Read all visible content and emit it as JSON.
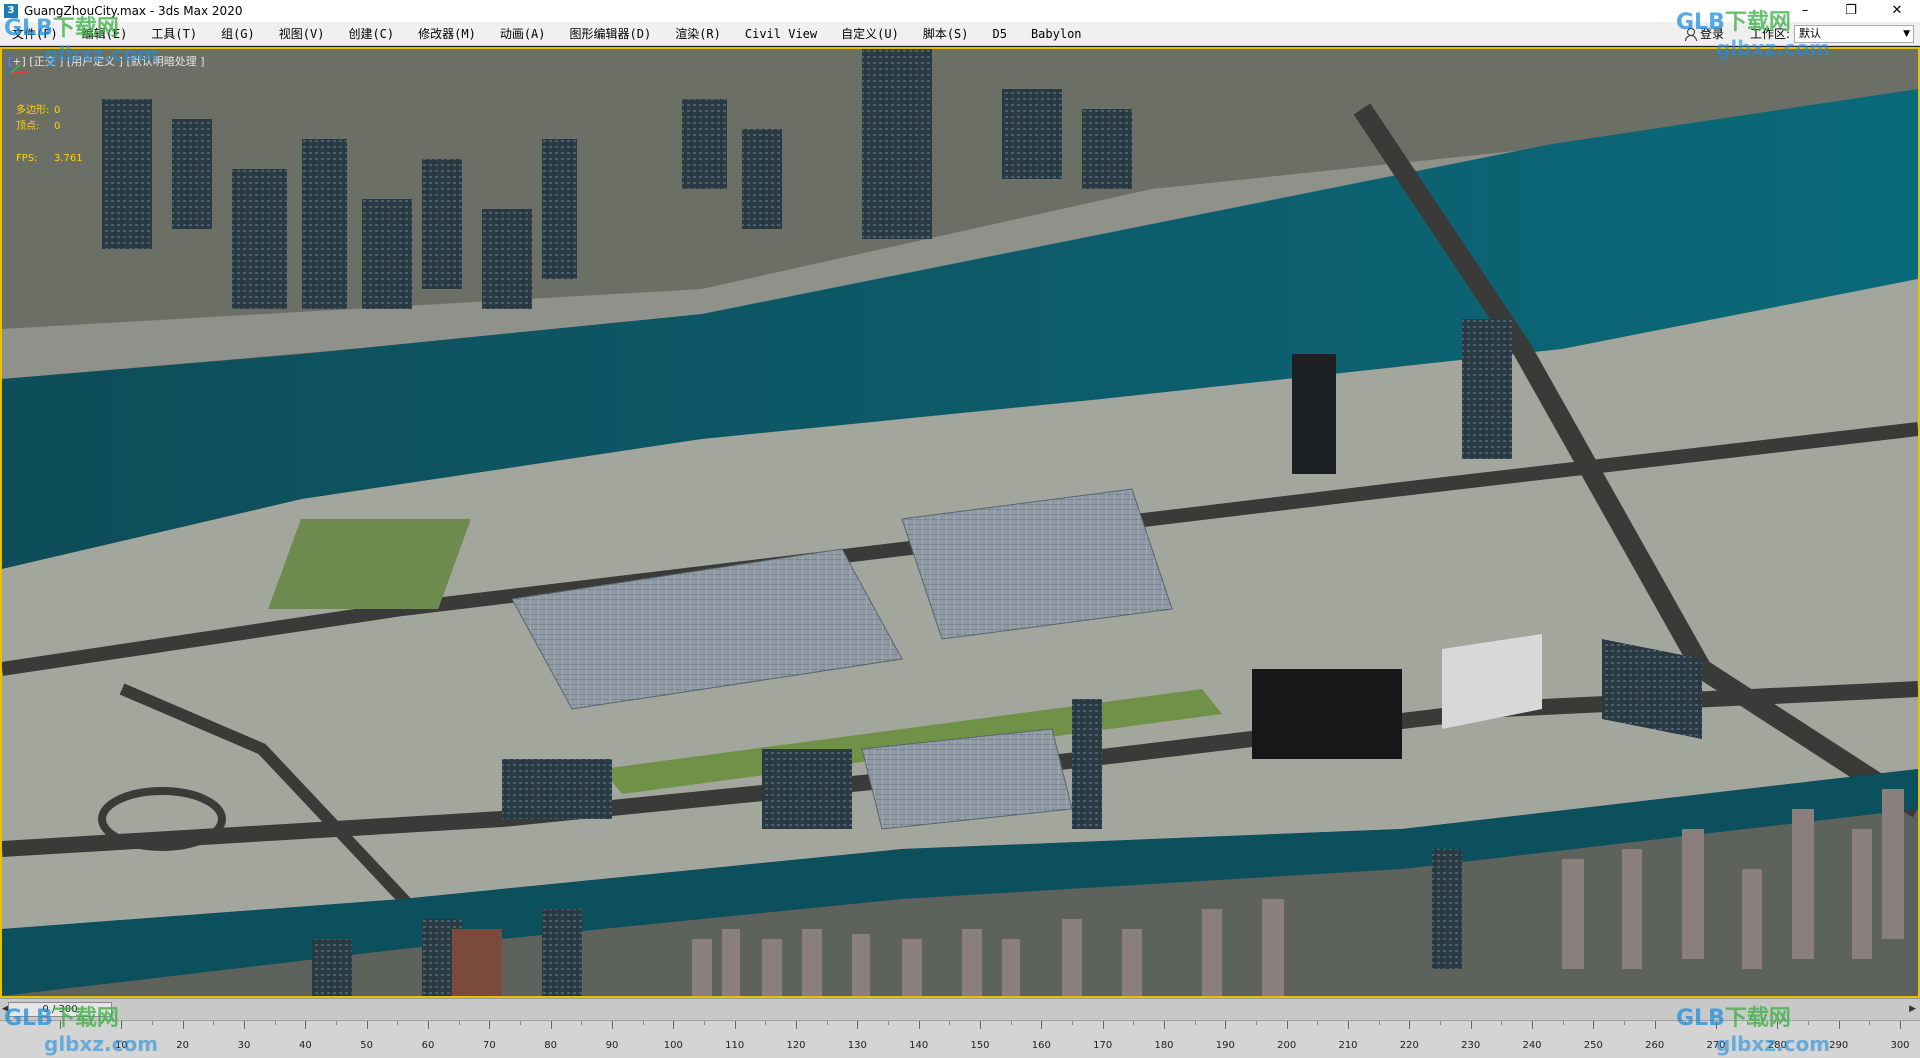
{
  "window": {
    "title": "GuangZhouCity.max - 3ds Max 2020",
    "app_icon": "3"
  },
  "menu": {
    "items": [
      "文件(F)",
      "编辑(E)",
      "工具(T)",
      "组(G)",
      "视图(V)",
      "创建(C)",
      "修改器(M)",
      "动画(A)",
      "图形编辑器(D)",
      "渲染(R)",
      "Civil View",
      "自定义(U)",
      "脚本(S)",
      "D5",
      "Babylon"
    ],
    "login_label": "登录",
    "workspace_label": "工作区:",
    "workspace_value": "默认"
  },
  "viewport": {
    "label": "[+] [正交 ] [用户定义 ] [默认明暗处理 ]",
    "stats": {
      "polygons_label": "多边形:",
      "polygons_value": "0",
      "vertices_label": "顶点:",
      "vertices_value": "0",
      "fps_label": "FPS:",
      "fps_value": "3.761"
    }
  },
  "timeslider": {
    "current": "0 / 300"
  },
  "timeline": {
    "labels": [
      "10",
      "20",
      "30",
      "40",
      "50",
      "60",
      "70",
      "80",
      "90",
      "100",
      "110",
      "120",
      "130",
      "140",
      "150",
      "160",
      "170",
      "180",
      "190",
      "200",
      "210",
      "220",
      "230",
      "240",
      "250",
      "260",
      "270",
      "280",
      "290",
      "300"
    ]
  },
  "watermark": {
    "brand": "GLB",
    "cn": "下载网",
    "site": "glbxz.com"
  },
  "colors": {
    "viewport_border": "#e8c000",
    "stats_text": "#ffd400",
    "river": "#0c5565",
    "ground": "#9ea39b"
  },
  "icons": {
    "login": "user-icon",
    "minimize": "minimize-icon",
    "maximize": "maximize-icon",
    "close": "close-icon",
    "workspace_dropdown": "chevron-down-icon",
    "axis": "axis-gizmo-icon"
  }
}
